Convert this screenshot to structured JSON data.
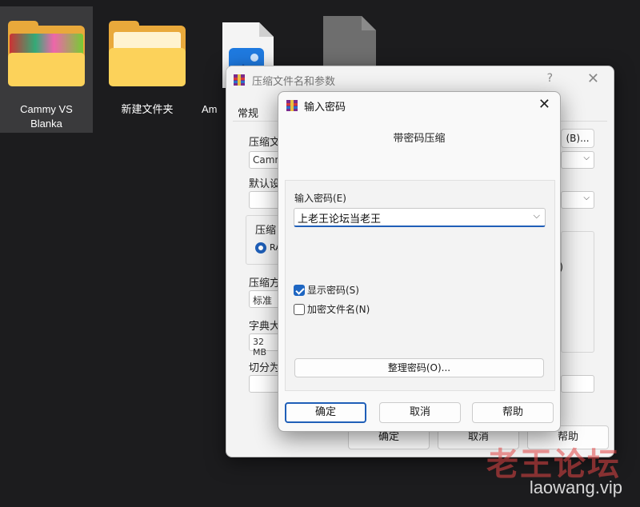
{
  "desktop": {
    "icons": [
      {
        "label": "Cammy VS Blanka"
      },
      {
        "label": "新建文件夹"
      },
      {
        "label": "Am"
      }
    ]
  },
  "back_dialog": {
    "title": "压缩文件名和参数",
    "help_glyph": "?",
    "close_glyph": "✕",
    "tab_general": "常规",
    "label_archive_name": "压缩文",
    "archive_name_value": "Camm",
    "browse_button": "(B)...",
    "label_default": "默认设",
    "label_format": "压缩",
    "format_option": "RA",
    "label_method": "压缩方",
    "method_value": "标准",
    "label_dict": "字典大",
    "dict_value": "32 MB",
    "label_split": "切分为",
    "right_paren": ")",
    "ok_button": "确定",
    "cancel_button": "取消",
    "help_button": "帮助"
  },
  "password_dialog": {
    "title": "输入密码",
    "close_glyph": "✕",
    "subtitle": "带密码压缩",
    "password_label": "输入密码(E)",
    "password_value": "上老王论坛当老王",
    "show_password_label": "显示密码(S)",
    "show_password_checked": true,
    "encrypt_names_label": "加密文件名(N)",
    "encrypt_names_checked": false,
    "organize_button": "整理密码(O)...",
    "ok_button": "确定",
    "cancel_button": "取消",
    "help_button": "帮助"
  },
  "watermark": {
    "cn": "老王论坛",
    "url": "laowang.vip"
  },
  "colors": {
    "desktop_bg": "#1c1c1e",
    "accent": "#1f5fb8",
    "folder": "#fcd25a",
    "watermark_red": "#e14646"
  }
}
